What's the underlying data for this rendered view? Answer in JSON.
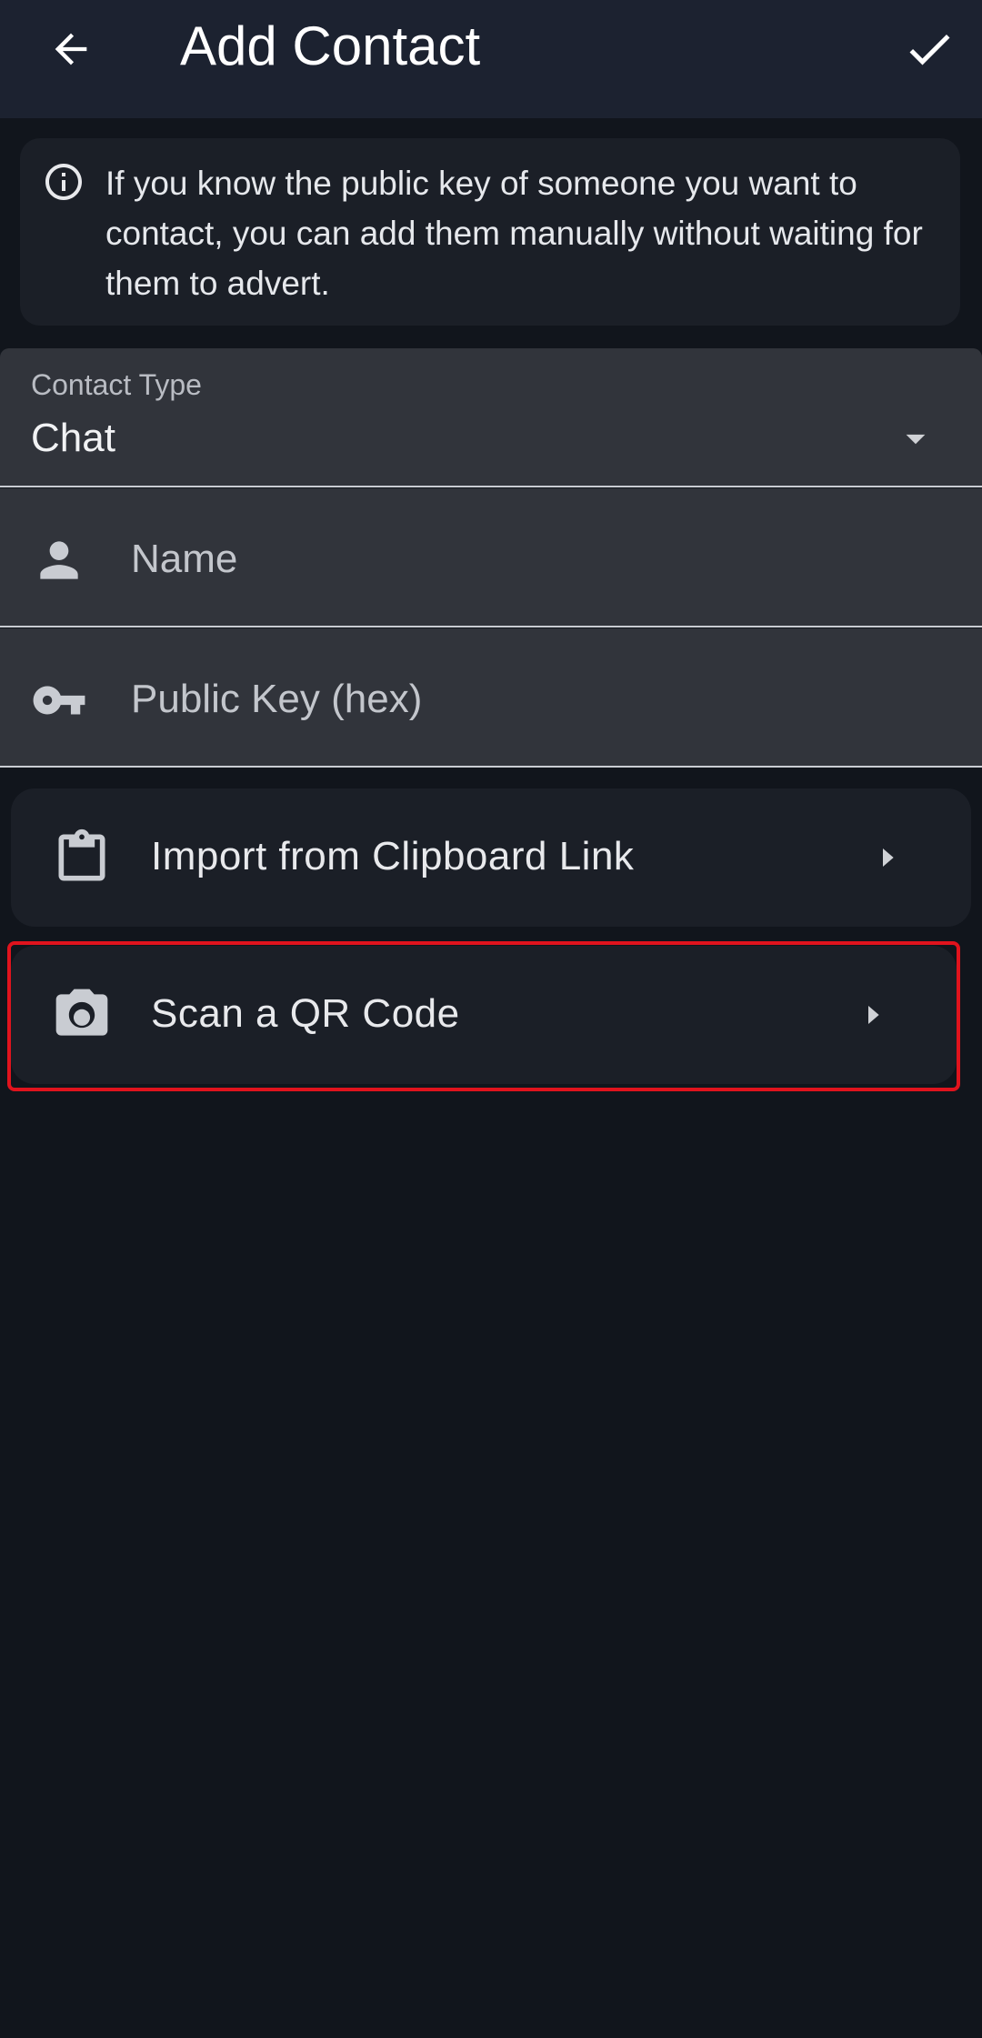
{
  "app_bar": {
    "title": "Add Contact",
    "back_icon": "arrow-left-icon",
    "confirm_icon": "check-icon"
  },
  "info": {
    "icon": "info-circle-icon",
    "text": "If you know the public key of someone you want to contact, you can add them manually without waiting for them to advert."
  },
  "form": {
    "contact_type": {
      "label": "Contact Type",
      "value": "Chat",
      "icon": "dropdown-caret-icon"
    },
    "name": {
      "placeholder": "Name",
      "icon": "person-icon"
    },
    "public_key": {
      "placeholder": "Public Key (hex)",
      "icon": "key-icon"
    }
  },
  "actions": [
    {
      "label": "Import from Clipboard Link",
      "icon": "clipboard-icon",
      "arrow_icon": "chevron-right-icon"
    },
    {
      "label": "Scan a QR Code",
      "icon": "camera-icon",
      "arrow_icon": "chevron-right-icon"
    }
  ],
  "colors": {
    "background": "#11151c",
    "app_bar": "#1c2230",
    "card": "#1b1f27",
    "field": "#31343b",
    "highlight": "#e0131d"
  }
}
